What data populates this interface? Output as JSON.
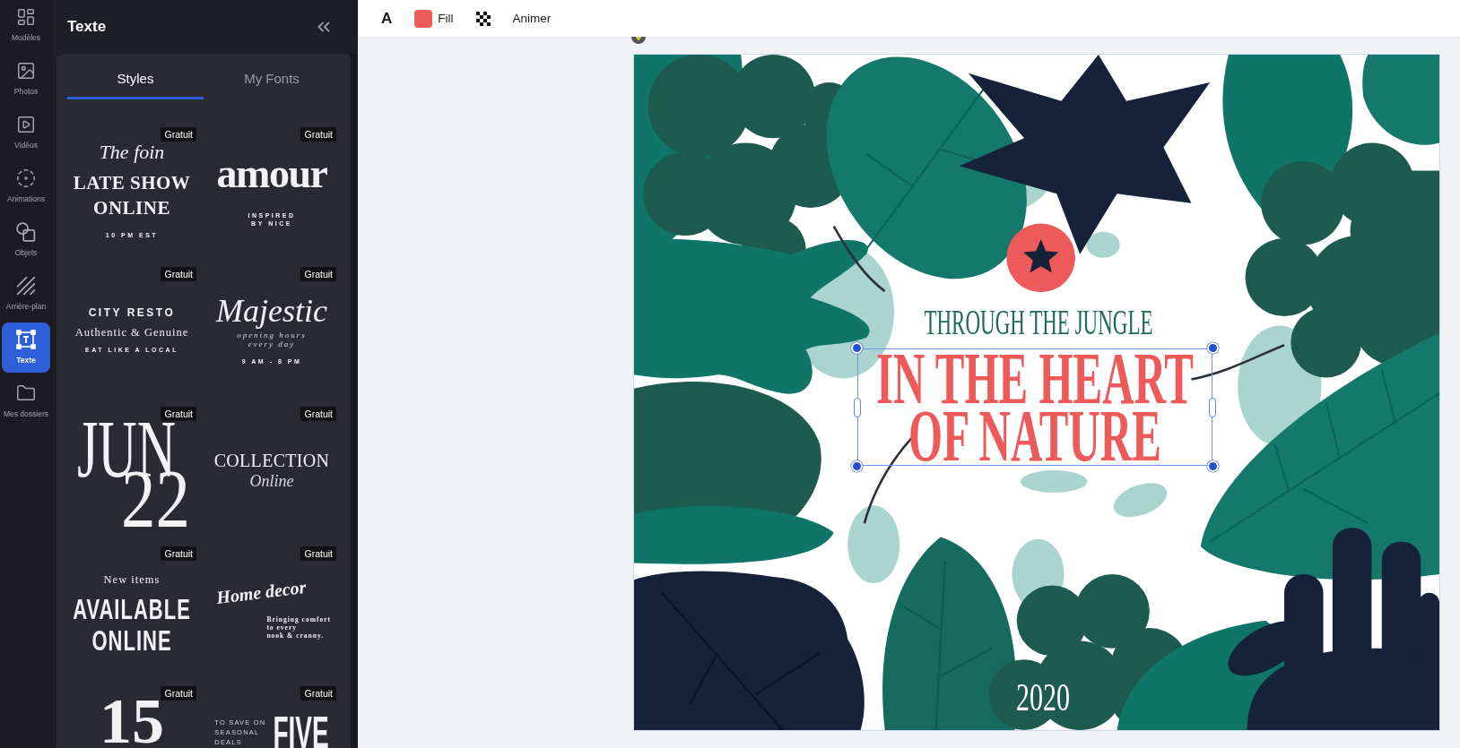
{
  "rail": {
    "items": [
      {
        "label": "Modèles",
        "selected": false
      },
      {
        "label": "Photos",
        "selected": false
      },
      {
        "label": "Vidéos",
        "selected": false
      },
      {
        "label": "Animations",
        "selected": false
      },
      {
        "label": "Objets",
        "selected": false
      },
      {
        "label": "Arrière-plan",
        "selected": false
      },
      {
        "label": "Texte",
        "selected": true
      },
      {
        "label": "Mes dossiers",
        "selected": false
      }
    ]
  },
  "panel": {
    "title": "Texte",
    "tabs": [
      {
        "label": "Styles",
        "selected": true
      },
      {
        "label": "My Fonts",
        "selected": false
      }
    ],
    "cards": [
      {
        "badge": "Gratuit",
        "lines": [
          {
            "kind": "script",
            "text": "The foin"
          },
          {
            "kind": "bold-serif",
            "text": "LATE SHOW\nONLINE"
          },
          {
            "kind": "tiny",
            "text": "10 PM EST"
          }
        ]
      },
      {
        "badge": "Gratuit",
        "lines": [
          {
            "kind": "heavy",
            "text": "amour"
          },
          {
            "kind": "tiny",
            "text": "INSPIRED\nBY NICE"
          }
        ]
      },
      {
        "badge": "Gratuit",
        "lines": [
          {
            "kind": "spaced-sans",
            "text": "CITY RESTO"
          },
          {
            "kind": "spaced-serif",
            "text": "Authentic & Genuine"
          },
          {
            "kind": "tiny",
            "text": "EAT LIKE A LOCAL"
          }
        ]
      },
      {
        "badge": "Gratuit",
        "lines": [
          {
            "kind": "calligraphy",
            "text": "Majestic"
          },
          {
            "kind": "italic-small",
            "text": "opening hours\nevery day"
          },
          {
            "kind": "tiny",
            "text": "9 AM - 8 PM"
          }
        ]
      },
      {
        "badge": "Gratuit",
        "lines": [
          {
            "kind": "tall-left",
            "text": "JUN"
          },
          {
            "kind": "tall-right",
            "text": "22"
          }
        ]
      },
      {
        "badge": "Gratuit",
        "lines": [
          {
            "kind": "serif-caps",
            "text": "COLLECTION"
          },
          {
            "kind": "serif-italic",
            "text": "Online"
          }
        ]
      },
      {
        "badge": "Gratuit",
        "lines": [
          {
            "kind": "spaced-serif",
            "text": "New items"
          },
          {
            "kind": "condensed",
            "text": "AVAILABLE\nONLINE"
          }
        ]
      },
      {
        "badge": "Gratuit",
        "lines": [
          {
            "kind": "brush",
            "text": "Home decor"
          },
          {
            "kind": "note",
            "text": "Bringing comfort\nto every\nnook & cranny."
          }
        ]
      },
      {
        "badge": "Gratuit",
        "lines": [
          {
            "kind": "number",
            "text": "15"
          }
        ]
      },
      {
        "badge": "Gratuit",
        "lines": [
          {
            "kind": "side",
            "text": "TO SAVE ON\nSEASONAL\nDEALS"
          },
          {
            "kind": "condensed-big",
            "text": "FIVE"
          }
        ]
      }
    ]
  },
  "toolbar": {
    "font_button": "A",
    "fill": {
      "label": "Fill",
      "color": "#ef5b5b"
    },
    "animate": "Animer"
  },
  "canvas": {
    "subtitle": "THROUGH THE JUNGLE",
    "heading": {
      "text": "IN THE HEART\nOF NATURE",
      "selected": true
    },
    "year": "2020"
  }
}
